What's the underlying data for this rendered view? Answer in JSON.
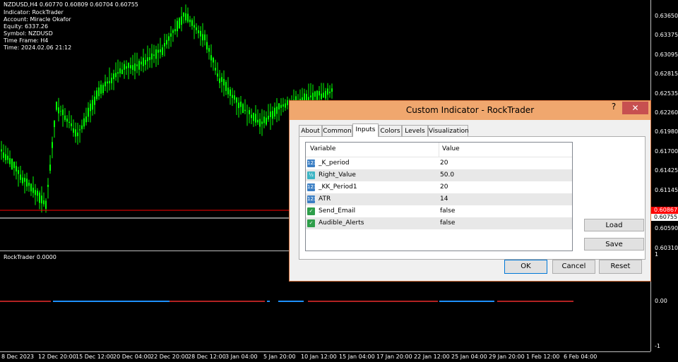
{
  "chart": {
    "info_lines": [
      "NZDUSD,H4  0.60770 0.60809 0.60704 0.60755",
      "Indicator: RockTrader",
      "Account: Miracle Okafor",
      "Equity: 6337.26",
      "Symbol: NZDUSD",
      "Time Frame: H4",
      "Time: 2024.02.06 21:12"
    ],
    "price_ticks": [
      "0.63650",
      "0.63375",
      "0.63095",
      "0.62815",
      "0.62535",
      "0.62260",
      "0.61980",
      "0.61700",
      "0.61425",
      "0.61145",
      "0.60865",
      "0.60590",
      "0.60310"
    ],
    "price_tag_red": "0.60867",
    "price_tag_white": "0.60755",
    "colors": {
      "candle": "#00ff00",
      "red_line": "#ff0000",
      "white_line": "#ffffff",
      "blue_seg": "#1e90ff",
      "red_seg": "#b22222"
    }
  },
  "subwindow": {
    "label": "RockTrader 0.0000",
    "axis_top": "1",
    "axis_mid": "0.00",
    "axis_bottom": "-1"
  },
  "time_axis": [
    "8 Dec 2023",
    "12 Dec 20:00",
    "15 Dec 12:00",
    "20 Dec 04:00",
    "22 Dec 20:00",
    "28 Dec 12:00",
    "3 Jan 04:00",
    "5 Jan 20:00",
    "10 Jan 12:00",
    "15 Jan 04:00",
    "17 Jan 20:00",
    "22 Jan 12:00",
    "25 Jan 04:00",
    "29 Jan 20:00",
    "1 Feb 12:00",
    "6 Feb 04:00"
  ],
  "dialog": {
    "title": "Custom Indicator - RockTrader",
    "help": "?",
    "close": "✕",
    "tabs": [
      "About",
      "Common",
      "Inputs",
      "Colors",
      "Levels",
      "Visualization"
    ],
    "active_tab": "Inputs",
    "columns": [
      "Variable",
      "Value"
    ],
    "rows": [
      {
        "icon": "int-icon",
        "glyph": "123",
        "variable": "_K_period",
        "value": "20"
      },
      {
        "icon": "double-icon",
        "glyph": "½",
        "variable": "Right_Value",
        "value": "50.0"
      },
      {
        "icon": "int-icon",
        "glyph": "123",
        "variable": "_KK_Period1",
        "value": "20"
      },
      {
        "icon": "int-icon",
        "glyph": "123",
        "variable": "ATR",
        "value": "14"
      },
      {
        "icon": "bool-icon",
        "glyph": "✓",
        "variable": "Send_Email",
        "value": "false"
      },
      {
        "icon": "bool-icon",
        "glyph": "✓",
        "variable": "Audible_Alerts",
        "value": "false"
      }
    ],
    "load": "Load",
    "save": "Save",
    "ok": "OK",
    "cancel": "Cancel",
    "reset": "Reset"
  }
}
